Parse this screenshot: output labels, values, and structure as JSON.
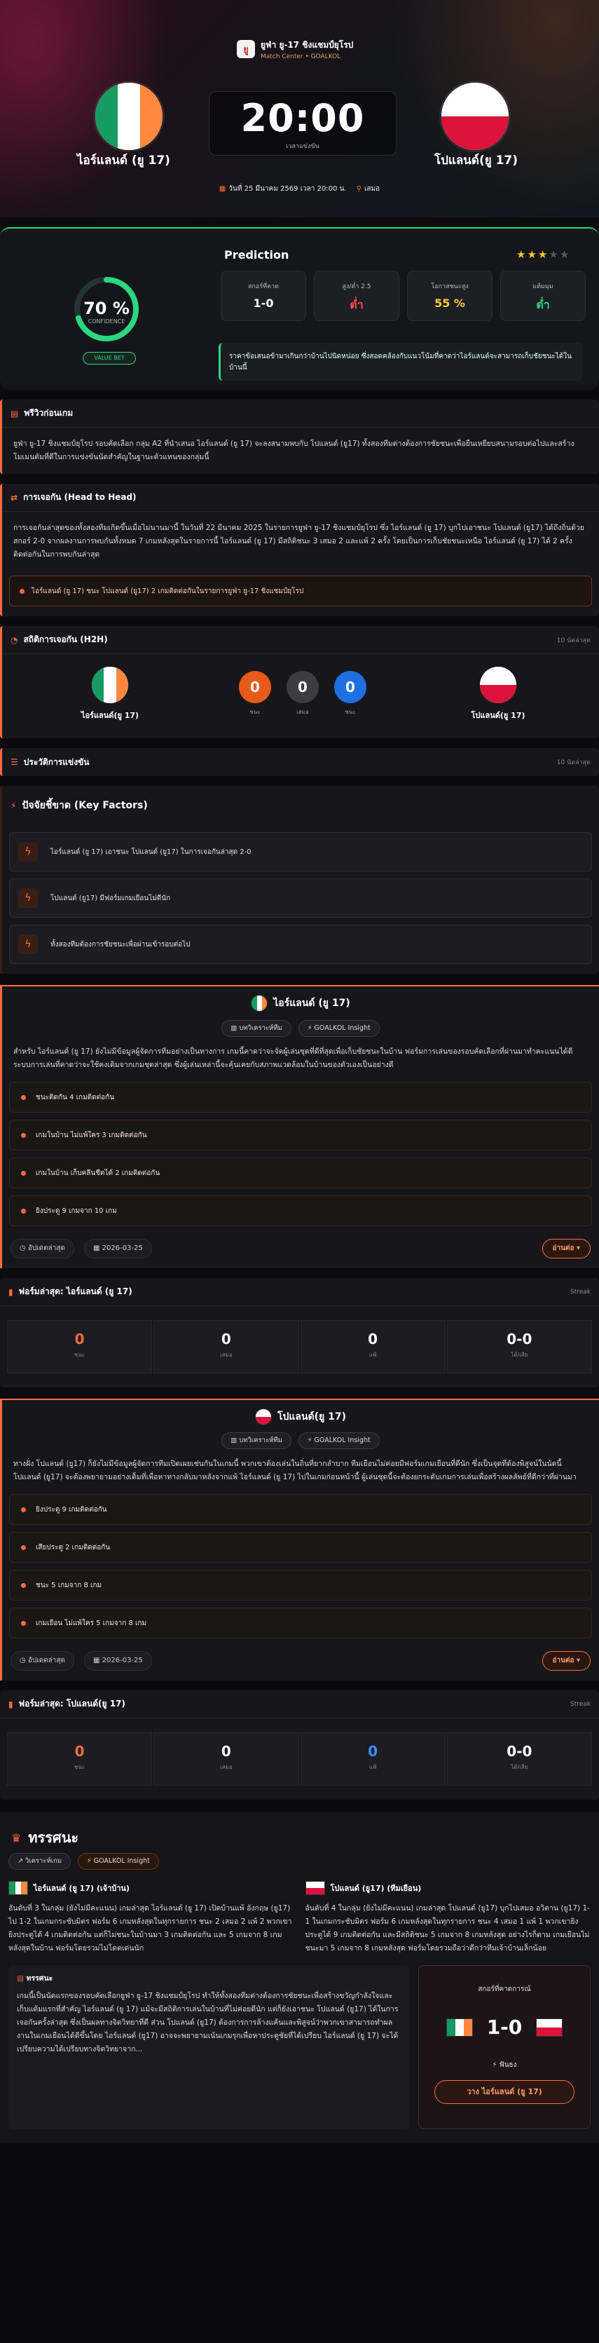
{
  "header": {
    "league_logo_text": "ยู",
    "league_name": "ยูฟ่า ยู-17 ชิงแชมป์ยุโรป",
    "league_sub": "Match Center • GOALKOL",
    "home_team": "ไอร์แลนด์ (ยู 17)",
    "away_team": "โปแลนด์(ยู 17)",
    "kickoff": "20:00",
    "kickoff_note": "เวลาแข่งขัน",
    "date": "วันที่ 25 มีนาคม 2569 เวลา 20:00 น.",
    "venue": "เสมอ"
  },
  "prediction": {
    "confidence_value": "70 %",
    "confidence_pct": 70,
    "confidence_label": "CONFIDENCE",
    "badge": "VALUE BET",
    "title": "Prediction",
    "stars_filled": 3,
    "stars_total": 5,
    "stats": [
      {
        "label": "สกอร์ที่คาด",
        "value": "1-0",
        "color": "#ffffff"
      },
      {
        "label": "สูง/ต่ำ 2.5",
        "value": "ต่ำ",
        "color": "#ff4d4d"
      },
      {
        "label": "โอกาสชนะสูง",
        "value": "55 %",
        "color": "#ffcc33"
      },
      {
        "label": "แต้มมุม",
        "value": "ต่ำ",
        "color": "#2bd67f"
      }
    ],
    "note": "ราคาข้อเสนอข้ามาเกินกว่าบ้านไปนิดหน่อย ซึ่งสอดคล้องกับแนวโน้มที่คาดว่าไอร์แลนด์จะสามารถเก็บชัยชนะได้ในบ้านนี้"
  },
  "preview": {
    "title": "พรีวิวก่อนเกม",
    "text": "ยูฟ่า ยู-17 ชิงแชมป์ยุโรป รอบคัดเลือก กลุ่ม A2 ที่นำเสนอ ไอร์แลนด์ (ยู 17) จะลงสนามพบกับ โปแลนด์ (ยู17) ทั้งสองทีมต่างต้องการชัยชนะเพื่อยืนเหยียบสนามรอบต่อไปและสร้างโมเมนตัมที่ดีในการแข่งขันนัดสำคัญในฐานะตัวแทนของกลุ่มนี้"
  },
  "h2h_history": {
    "title": "การเจอกัน (Head to Head)",
    "text": "การเจอกันล่าสุดของทั้งสองทีมเกิดขึ้นเมื่อไม่นานมานี้ ในวันที่ 22 มีนาคม 2025 ในรายการยูฟ่า ยู-17 ชิงแชมป์ยุโรป ซึ่ง ไอร์แลนด์ (ยู 17) บุกไปเอาชนะ โปแลนด์ (ยู17) ได้ถึงถิ่นด้วยสกอร์ 2-0 จากผลงานการพบกันทั้งหมด 7 เกมหลังสุดในรายการนี้ ไอร์แลนด์ (ยู 17) มีสถิติชนะ 3 เสมอ 2 และแพ้ 2 ครั้ง โดยเป็นการเก็บชัยชนะเหนือ ไอร์แลนด์ (ยู 17) ได้ 2 ครั้งติดต่อกันในการพบกันล่าสุด",
    "quote": "ไอร์แลนด์ (ยู 17) ชนะ โปแลนด์ (ยู17) 2 เกมติดต่อกันในรายการยูฟ่า ยู-17 ชิงแชมป์ยุโรป"
  },
  "h2h_stats": {
    "title": "สถิติการเจอกัน (H2H)",
    "range": "10 นัดล่าสุด",
    "home": "ไอร์แลนด์(ยู 17)",
    "away": "โปแลนด์(ยู 17)",
    "wins": "0",
    "wins_label": "ชนะ",
    "draws": "0",
    "draws_label": "เสมอ",
    "losses": "0",
    "losses_label": "ชนะ"
  },
  "competition_history": {
    "title": "ประวัติการแข่งขัน",
    "range": "10 นัดล่าสุด"
  },
  "key_factors": {
    "title": "ปัจจัยชี้ขาด (Key Factors)",
    "items": [
      "ไอร์แลนด์ (ยู 17) เอาชนะ โปแลนด์ (ยู17) ในการเจอกันล่าสุด 2-0",
      "โปแลนด์ (ยู17) มีฟอร์มเกมเยือนไม่ดีนัก",
      "ทั้งสองทีมต้องการชัยชนะเพื่อผ่านเข้ารอบต่อไป"
    ]
  },
  "home_card": {
    "team": "ไอร์แลนด์ (ยู 17)",
    "pill_analysis": "บทวิเคราะห์ทีม",
    "pill_insight": "GOALKOL Insight",
    "text": "สำหรับ ไอร์แลนด์ (ยู 17) ยังไม่มีข้อมูลผู้จัดการทีมอย่างเป็นทางการ เกมนี้คาดว่าจะจัดผู้เล่นชุดที่ดีที่สุดเพื่อเก็บชัยชนะในบ้าน ฟอร์มการเล่นของรอบคัดเลือกที่ผ่านมาทำคะแนนได้ดี ระบบการเล่นที่คาดว่าจะใช้คงเดิมจากเกมชุดล่าสุด ซึ่งผู้เล่นเหล่านี้จะคุ้นเคยกับสภาพแวดล้อมในบ้านของตัวเองเป็นอย่างดี",
    "bullets": [
      "ชนะติดกัน 4 เกมติดต่อกัน",
      "เกมในบ้าน ไม่แพ้ใคร 3 เกมติดต่อกัน",
      "เกมในบ้าน เก็บคลีนชีตได้ 2 เกมติดต่อกัน",
      "ยิงประตู 9 เกมจาก 10 เกม"
    ],
    "foot_label": "อัปเดตล่าสุด",
    "foot_date": "2026-03-25",
    "read_more": "อ่านต่อ ▾"
  },
  "home_form": {
    "title": "ฟอร์มล่าสุด: ไอร์แลนด์ (ยู 17)",
    "right": "Streak",
    "cells": [
      {
        "n": "0",
        "s": "ชนะ",
        "c": "#ff6b3d"
      },
      {
        "n": "0",
        "s": "เสมอ",
        "c": "#ffffff"
      },
      {
        "n": "0",
        "s": "แพ้",
        "c": "#ffffff"
      },
      {
        "n": "0-0",
        "s": "ได้/เสีย",
        "c": "#ffffff"
      }
    ]
  },
  "away_card": {
    "team": "โปแลนด์(ยู 17)",
    "pill_analysis": "บทวิเคราะห์ทีม",
    "pill_insight": "GOALKOL Insight",
    "text": "ทางฝั่ง โปแลนด์ (ยู17) ก็ยังไม่มีข้อมูลผู้จัดการทีมเปิดเผยเช่นกันในเกมนี้ พวกเขาต้องเล่นในถิ่นที่ยากลำบาก ทีมเยือนไม่ค่อยมีฟอร์มเกมเยือนที่ดีนัก ซึ่งเป็นจุดที่ต้องพิสูจน์ในนัดนี้ โปแลนด์ (ยู17) จะต้องพยายามอย่างเต็มที่เพื่อหาทางกลับมาหลังจากแพ้ ไอร์แลนด์ (ยู 17) ไปในเกมก่อนหน้านี้ ผู้เล่นชุดนี้จะต้องยกระดับเกมการเล่นเพื่อสร้างผลลัพธ์ที่ดีกว่าที่ผ่านมา",
    "bullets": [
      "ยิงประตู 9 เกมติดต่อกัน",
      "เสียประตู 2 เกมติดต่อกัน",
      "ชนะ 5 เกมจาก 8 เกม",
      "เกมเยือน ไม่แพ้ใคร 5 เกมจาก 8 เกม"
    ],
    "foot_label": "อัปเดตล่าสุด",
    "foot_date": "2026-03-25",
    "read_more": "อ่านต่อ ▾"
  },
  "away_form": {
    "title": "ฟอร์มล่าสุด: โปแลนด์(ยู 17)",
    "right": "Streak",
    "cells": [
      {
        "n": "0",
        "s": "ชนะ",
        "c": "#ff6b3d"
      },
      {
        "n": "0",
        "s": "เสมอ",
        "c": "#ffffff"
      },
      {
        "n": "0",
        "s": "แพ้",
        "c": "#3b8cff"
      },
      {
        "n": "0-0",
        "s": "ได้/เสีย",
        "c": "#ffffff"
      }
    ]
  },
  "analysis": {
    "title": "ทรรศนะ",
    "tab1": "วิเคราะห์เกม",
    "tab2": "GOALKOL Insight",
    "home_head": "ไอร์แลนด์ (ยู 17) (เจ้าบ้าน)",
    "home_text": "อันดับที่ 3 ในกลุ่ม (ยังไม่มีคะแนน) เกมล่าสุด ไอร์แลนด์ (ยู 17) เปิดบ้านแพ้ อังกฤษ (ยู17) ไป 1-2 ในเกมกระชับมิตร ฟอร์ม 6 เกมหลังสุดในทุกรายการ ชนะ 2 เสมอ 2 แพ้ 2 พวกเขายิงประตูได้ 4 เกมติดต่อกัน แต่ก็ไม่ชนะในบ้านมา 3 เกมติดต่อกัน และ 5 เกมจาก 8 เกมหลังสุดในบ้าน ฟอร์มโดยรวมไม่โดดเด่นนัก",
    "away_head": "โปแลนด์ (ยู17) (ทีมเยือน)",
    "away_text": "อันดับที่ 4 ในกลุ่ม (ยังไม่มีคะแนน) เกมล่าสุด โปแลนด์ (ยู17) บุกไปเสมอ อวิตาน (ยู17) 1-1 ในเกมกระชับมิตร ฟอร์ม 6 เกมหลังสุดในทุกรายการ ชนะ 4 เสมอ 1 แพ้ 1 พวกเขายิงประตูได้ 9 เกมติดต่อกัน และมีสถิติชนะ 5 เกมจาก 8 เกมหลังสุด อย่างไรก็ตาม เกมเยือนไม่ชนะมา 5 เกมจาก 8 เกมหลังสุด ฟอร์มโดยรวมถือว่าดีกว่าทีมเจ้าบ้านเล็กน้อย",
    "verdict_title": "ทรรศนะ",
    "verdict_text": "เกมนี้เป็นนัดแรกของรอบคัดเลือกยูฟ่า ยู-17 ชิงแชมป์ยุโรป ทำให้ทั้งสองทีมต่างต้องการชัยชนะเพื่อสร้างขวัญกำลังใจและเก็บแต้มแรกที่สำคัญ ไอร์แลนด์ (ยู 17) แม้จะมีสถิติการเล่นในบ้านที่ไม่ค่อยดีนัก แต่ก็ยังเอาชนะ โปแลนด์ (ยู17) ได้ในการเจอกันครั้งล่าสุด ซึ่งเป็นผลทางจิตวิทยาที่ดี ส่วน โปแลนด์ (ยู17) ต้องการการล้างแค้นและพิสูจน์ว่าพวกเขาสามารถทำผลงานในเกมเยือนได้ดีขึ้นโดย ไอร์แลนด์ (ยู17) อาจจะพยายามเน้นเกมรุกเพื่อหาประตูชัยที่ได้เปรียบ ไอร์แลนด์ (ยู 17) จะได้เปรียบความได้เปรียบทางจิตวิทยาจาก...",
    "side_title": "สกอร์ที่คาดการณ์",
    "side_score": "1-0",
    "side_pick_label": "ฟันธง",
    "side_pick": "วาง ไอร์แลนด์ (ยู 17)"
  }
}
